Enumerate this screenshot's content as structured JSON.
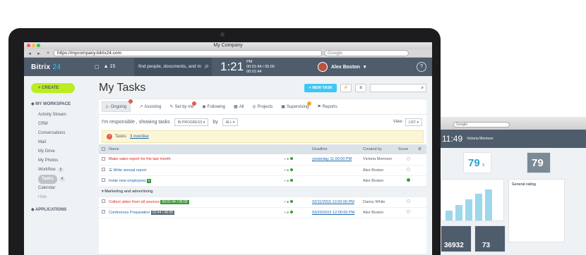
{
  "browser": {
    "window_title": "My Company",
    "url": "https://mycompany.bitrix24.com",
    "search_placeholder": "Google"
  },
  "header": {
    "logo_main": "Bitrix",
    "logo_accent": "24",
    "notifications": "15",
    "search_placeholder": "find people, documents, and m",
    "time": "1:21",
    "time_suffix": "PM",
    "timer_primary": "00:01:44 / 05:00",
    "timer_secondary": "00:01:44",
    "user_name": "Alex Boston",
    "help": "?"
  },
  "sidebar": {
    "create_label": "CREATE",
    "workspace_label": "MY WORKSPACE",
    "items": [
      {
        "label": "Activity Stream",
        "badge": ""
      },
      {
        "label": "CRM",
        "badge": ""
      },
      {
        "label": "Conversations",
        "badge": ""
      },
      {
        "label": "Mail",
        "badge": ""
      },
      {
        "label": "My Drive",
        "badge": ""
      },
      {
        "label": "My Photos",
        "badge": ""
      },
      {
        "label": "Workflow",
        "badge": "6"
      },
      {
        "label": "Tasks",
        "badge": "4"
      },
      {
        "label": "Calendar",
        "badge": ""
      }
    ],
    "hide_label": "Hide",
    "applications_label": "APPLICATIONS"
  },
  "main": {
    "title": "My Tasks",
    "new_task_label": "+ NEW TASK",
    "tabs": [
      {
        "label": "Ongoing"
      },
      {
        "label": "Assisting"
      },
      {
        "label": "Set by me"
      },
      {
        "label": "Following"
      },
      {
        "label": "All"
      },
      {
        "label": "Projects"
      },
      {
        "label": "Supervising"
      },
      {
        "label": "Reports"
      }
    ],
    "filter_text_1": "I'm responsible , showing tasks",
    "filter_status": "IN PROGRESS",
    "filter_by": "by",
    "filter_by_value": "ALL",
    "view_label": "View",
    "view_value": "LIST",
    "warning_prefix": "Tasks:",
    "warning_link": "3 overdue",
    "columns": {
      "name": "Name",
      "deadline": "Deadline",
      "created_by": "Created by",
      "score": "Score"
    },
    "rows": [
      {
        "name": "Make sales report for the last month",
        "deadline": "yesterday 11:00:00 PM",
        "created_by": "Victoria Morrison",
        "style": "red"
      },
      {
        "name": "Write annual report",
        "deadline": "",
        "created_by": "Alex Boston",
        "style": "blue"
      },
      {
        "name": "Invite new employees",
        "deadline": "",
        "created_by": "Alex Boston",
        "style": "blue"
      }
    ],
    "group_label": "Marketing and advertising",
    "group_rows": [
      {
        "name": "Collect video from all sources",
        "timer": "00:01:44 / 05:00",
        "deadline": "02/11/2015 12:00:00 PM",
        "created_by": "Danny White",
        "style": "red"
      },
      {
        "name": "Conference Preparation",
        "timer": "02:44 / 06:00",
        "deadline": "03/20/2015 12:00:00 PM",
        "created_by": "Alex Boston",
        "style": "blue"
      }
    ]
  },
  "monitor": {
    "search_placeholder": "Google",
    "time": "11:49",
    "user": "Victoria Morrison",
    "stat_1": "79",
    "stat_1_suffix": "x",
    "stat_2": "79",
    "stat_3": "36932",
    "stat_4": "73",
    "section_label": "General rating"
  }
}
